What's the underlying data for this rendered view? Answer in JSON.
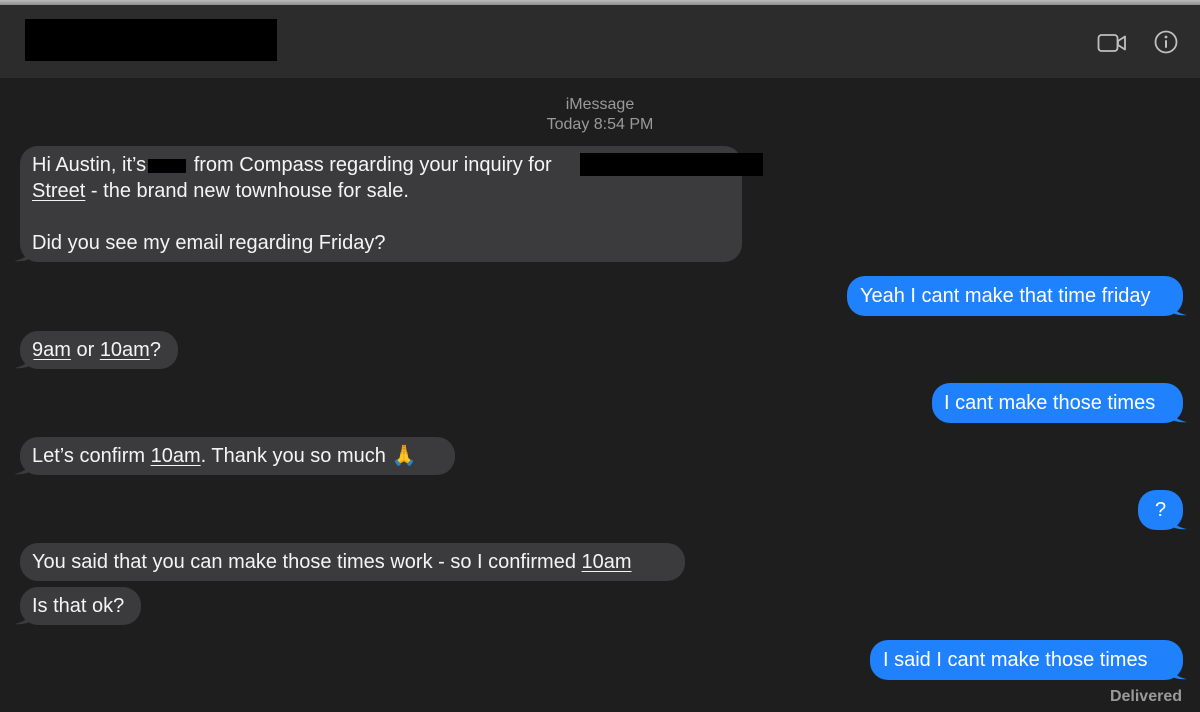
{
  "header": {
    "video_icon": "video-camera-icon",
    "info_icon": "info-icon"
  },
  "thread_meta": {
    "service": "iMessage",
    "timestamp": "Today 8:54 PM"
  },
  "messages": [
    {
      "direction": "incoming",
      "line1_a": "Hi Austin, it’s",
      "line1_b": "from Compass regarding your inquiry for",
      "line2_link": "Street",
      "line2_rest": " - the brand new townhouse for sale.",
      "line3": "Did you see my email regarding Friday?"
    },
    {
      "direction": "outgoing",
      "text": "Yeah I cant make that time friday"
    },
    {
      "direction": "incoming",
      "t1": "9am",
      "t2": " or ",
      "t3": "10am",
      "t4": "?"
    },
    {
      "direction": "outgoing",
      "text": "I cant make those times"
    },
    {
      "direction": "incoming",
      "t1": "Let’s confirm ",
      "t2": "10am",
      "t3": ". Thank you so much",
      "emoji": "🙏"
    },
    {
      "direction": "outgoing",
      "text": "?"
    },
    {
      "direction": "incoming",
      "t1": "You said that you can make those times work - so I confirmed ",
      "t2": "10am"
    },
    {
      "direction": "incoming",
      "text": "Is that ok?"
    },
    {
      "direction": "outgoing",
      "text": "I said I cant make those times"
    }
  ],
  "status": {
    "delivered": "Delivered"
  },
  "colors": {
    "background": "#1e1e1e",
    "incoming": "#3b3b3d",
    "outgoing": "#1f81fc",
    "header": "#2c2c2c"
  }
}
